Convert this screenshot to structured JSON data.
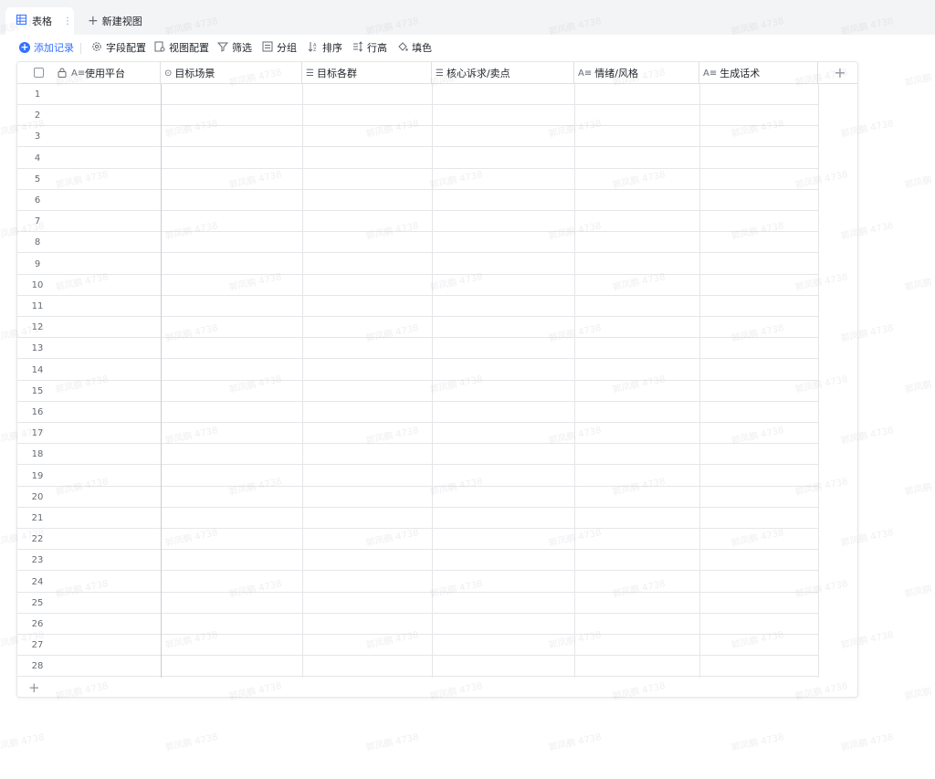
{
  "tabs": {
    "active_label": "表格",
    "more_glyph": "⋮",
    "new_view_label": "新建视图"
  },
  "toolbar": {
    "add_record": "添加记录",
    "field_config": "字段配置",
    "view_config": "视图配置",
    "filter": "筛选",
    "group": "分组",
    "sort": "排序",
    "row_height": "行高",
    "fill_color": "填色"
  },
  "columns": [
    {
      "label": "使用平台",
      "type_icon": "A≡"
    },
    {
      "label": "目标场景",
      "type_icon": "⊙"
    },
    {
      "label": "目标各群",
      "type_icon": "☰"
    },
    {
      "label": "核心诉求/卖点",
      "type_icon": "☰"
    },
    {
      "label": "情绪/风格",
      "type_icon": "A≡"
    },
    {
      "label": "生成话术",
      "type_icon": "A≡"
    }
  ],
  "rows": [
    "1",
    "2",
    "3",
    "4",
    "5",
    "6",
    "7",
    "8",
    "9",
    "10",
    "11",
    "12",
    "13",
    "14",
    "15",
    "16",
    "17",
    "18",
    "19",
    "20",
    "21",
    "22",
    "23",
    "24",
    "25",
    "26",
    "27",
    "28"
  ],
  "watermark": "郭凤鹏 4738",
  "colors": {
    "accent": "#3370ff",
    "border": "#dee0e3",
    "text": "#1f2329",
    "muted": "#646a73"
  }
}
